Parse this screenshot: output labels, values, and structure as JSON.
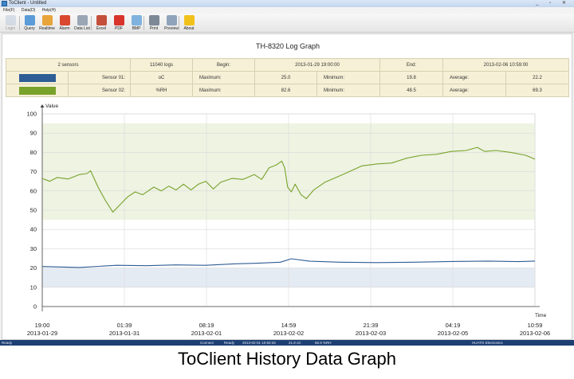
{
  "window": {
    "title": "ToClient - Untitled",
    "controls": "_ ▫ ✕"
  },
  "menu": [
    "File(F)",
    "Data(D)",
    "Help(H)"
  ],
  "toolbar": [
    {
      "label": "Login",
      "icon": "login-icon",
      "color": "#b9c6d8",
      "disabled": true
    },
    {
      "label": "Query",
      "icon": "query-icon",
      "color": "#5a9bd8"
    },
    {
      "label": "Realtime",
      "icon": "realtime-icon",
      "color": "#e8a43a"
    },
    {
      "label": "Alarm",
      "icon": "alarm-icon",
      "color": "#d9482f"
    },
    {
      "label": "Data List",
      "icon": "data-list-icon",
      "color": "#9aa6b4"
    },
    {
      "label": "Excel",
      "icon": "excel-icon",
      "color": "#c4503b"
    },
    {
      "label": "PDF",
      "icon": "pdf-icon",
      "color": "#d8342c"
    },
    {
      "label": "BMP",
      "icon": "bmp-icon",
      "color": "#7fb2de"
    },
    {
      "label": "Print",
      "icon": "print-icon",
      "color": "#7c8896"
    },
    {
      "label": "Preview",
      "icon": "preview-icon",
      "color": "#8fa4bb"
    },
    {
      "label": "About",
      "icon": "about-icon",
      "color": "#f1c21b"
    }
  ],
  "graph_title": "TH-8320 Log Graph",
  "summary": {
    "sensors": "2 sensors",
    "logs": "11040 logs",
    "begin_label": "Begin:",
    "begin_value": "2013-01-29 19:00:00",
    "end_label": "End:",
    "end_value": "2013-02-06 10:59:00",
    "rows": [
      {
        "color": "#2e5d95",
        "name": "Sensor 01:",
        "unit": "oC",
        "max_label": "Maximum:",
        "max": "25.0",
        "min_label": "Minimum:",
        "min": "19.8",
        "avg_label": "Average:",
        "avg": "22.2"
      },
      {
        "color": "#79a22b",
        "name": "Sensor 02:",
        "unit": "%RH",
        "max_label": "Maximum:",
        "max": "82.6",
        "min_label": "Minimum:",
        "min": "48.5",
        "avg_label": "Average:",
        "avg": "69.3"
      }
    ]
  },
  "chart_data": {
    "type": "line",
    "ylabel": "Value",
    "xlabel": "Time",
    "ylim": [
      0,
      100
    ],
    "yticks": [
      0,
      10,
      20,
      30,
      40,
      50,
      60,
      70,
      80,
      90,
      100
    ],
    "grid": true,
    "x_ticks": [
      {
        "x": 0,
        "time": "19:00",
        "date": "2013-01-29"
      },
      {
        "x": 1.1042,
        "time": "01:39",
        "date": "2013-01-31"
      },
      {
        "x": 2.2083,
        "time": "08:19",
        "date": "2013-02-01"
      },
      {
        "x": 3.3125,
        "time": "14:59",
        "date": "2013-02-02"
      },
      {
        "x": 4.4167,
        "time": "21:39",
        "date": "2013-02-03"
      },
      {
        "x": 5.5208,
        "time": "04:19",
        "date": "2013-02-05"
      },
      {
        "x": 6.625,
        "time": "10:59",
        "date": "2013-02-06"
      }
    ],
    "x_range_days": [
      0,
      6.625
    ],
    "bands": [
      {
        "series": "Sensor 02",
        "from": 45,
        "to": 95,
        "color": "#eef3e2"
      },
      {
        "series": "Sensor 01",
        "from": 10,
        "to": 20,
        "color": "#e5ebf3"
      }
    ],
    "series": [
      {
        "name": "Sensor 01",
        "color": "#2e5d95",
        "points": [
          [
            0,
            20.8
          ],
          [
            0.5,
            20.3
          ],
          [
            1.0,
            21.4
          ],
          [
            1.4,
            21.2
          ],
          [
            1.8,
            21.6
          ],
          [
            2.2,
            21.4
          ],
          [
            2.6,
            22.2
          ],
          [
            2.9,
            22.5
          ],
          [
            3.2,
            23.0
          ],
          [
            3.35,
            24.8
          ],
          [
            3.6,
            23.5
          ],
          [
            4.0,
            23.0
          ],
          [
            4.5,
            22.8
          ],
          [
            5.0,
            23.0
          ],
          [
            5.5,
            23.4
          ],
          [
            6.0,
            23.6
          ],
          [
            6.4,
            23.3
          ],
          [
            6.625,
            23.6
          ]
        ]
      },
      {
        "name": "Sensor 02",
        "color": "#79a22b",
        "points": [
          [
            0,
            66.5
          ],
          [
            0.1,
            65.0
          ],
          [
            0.2,
            67.0
          ],
          [
            0.35,
            66.2
          ],
          [
            0.5,
            68.5
          ],
          [
            0.6,
            69.0
          ],
          [
            0.65,
            70.5
          ],
          [
            0.75,
            62.0
          ],
          [
            0.85,
            55.0
          ],
          [
            0.95,
            49.0
          ],
          [
            1.05,
            53.0
          ],
          [
            1.15,
            57.0
          ],
          [
            1.25,
            59.5
          ],
          [
            1.35,
            58.0
          ],
          [
            1.5,
            62.0
          ],
          [
            1.6,
            60.0
          ],
          [
            1.7,
            62.5
          ],
          [
            1.8,
            60.5
          ],
          [
            1.9,
            63.5
          ],
          [
            2.0,
            60.5
          ],
          [
            2.1,
            63.5
          ],
          [
            2.2,
            65.0
          ],
          [
            2.3,
            61.0
          ],
          [
            2.4,
            64.5
          ],
          [
            2.55,
            66.5
          ],
          [
            2.7,
            66.0
          ],
          [
            2.85,
            68.5
          ],
          [
            2.95,
            66.0
          ],
          [
            3.05,
            72.0
          ],
          [
            3.15,
            73.5
          ],
          [
            3.22,
            75.5
          ],
          [
            3.26,
            72.0
          ],
          [
            3.3,
            62.0
          ],
          [
            3.35,
            59.5
          ],
          [
            3.4,
            63.5
          ],
          [
            3.48,
            58.0
          ],
          [
            3.55,
            56.0
          ],
          [
            3.65,
            60.5
          ],
          [
            3.8,
            64.5
          ],
          [
            3.95,
            67.0
          ],
          [
            4.1,
            69.5
          ],
          [
            4.3,
            73.0
          ],
          [
            4.5,
            74.0
          ],
          [
            4.7,
            74.5
          ],
          [
            4.9,
            77.0
          ],
          [
            5.1,
            78.5
          ],
          [
            5.3,
            79.0
          ],
          [
            5.5,
            80.5
          ],
          [
            5.7,
            81.0
          ],
          [
            5.85,
            82.6
          ],
          [
            5.95,
            80.5
          ],
          [
            6.1,
            81.0
          ],
          [
            6.3,
            80.0
          ],
          [
            6.5,
            78.5
          ],
          [
            6.625,
            76.5
          ]
        ]
      }
    ]
  },
  "status_bar": [
    "Ready",
    "Connect",
    "Ready",
    "2013-02-01 10:50:26",
    "21.8 oC",
    "66.9 %RH",
    "HUATO Electronics"
  ],
  "caption": "ToClient History Data Graph"
}
